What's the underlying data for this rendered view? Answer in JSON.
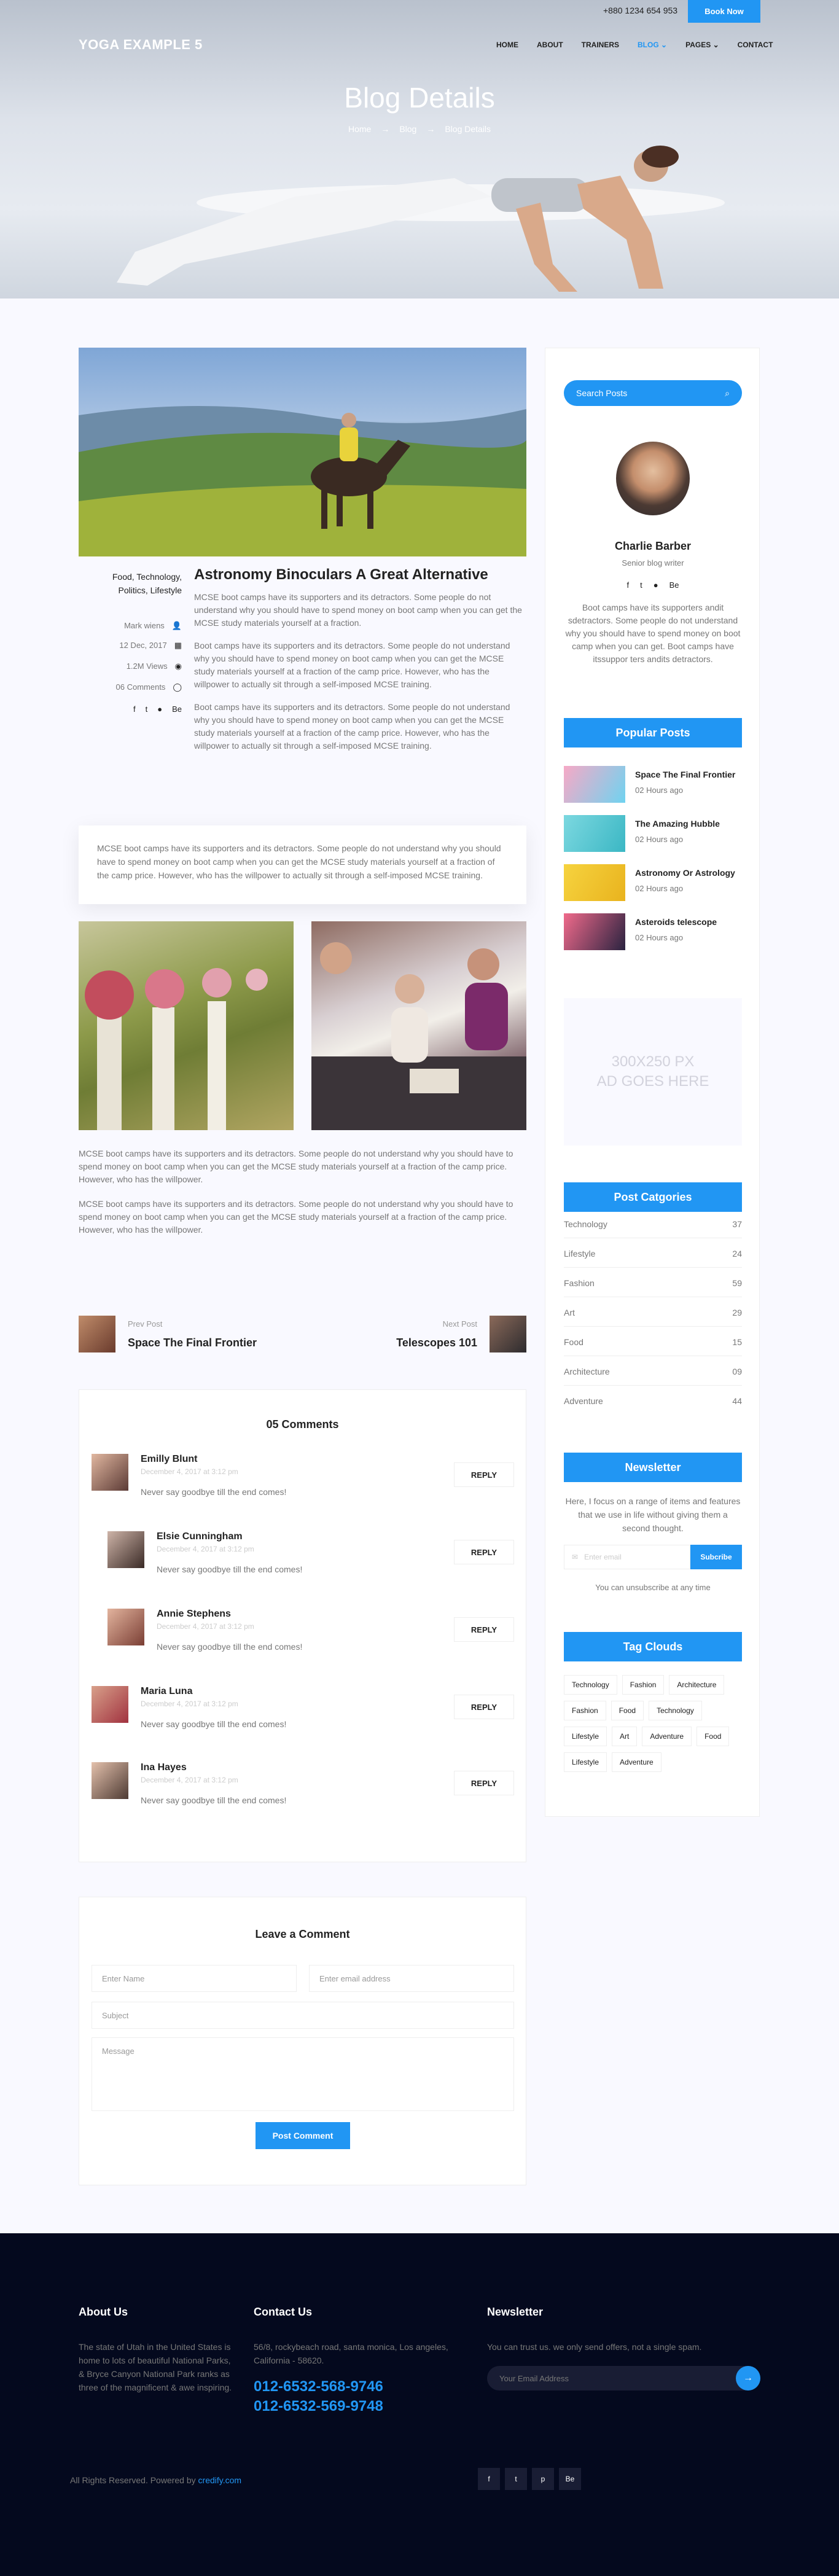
{
  "topbar": {
    "phone": "+880 1234 654 953",
    "book_label": "Book Now"
  },
  "brand": {
    "logo": "YOGA EXAMPLE 5"
  },
  "nav": {
    "items": [
      "HOME",
      "ABOUT",
      "TRAINERS",
      "BLOG",
      "PAGES",
      "CONTACT"
    ],
    "active": "BLOG"
  },
  "banner": {
    "title": "Blog Details",
    "crumbs": [
      "Home",
      "Blog",
      "Blog Details"
    ]
  },
  "post": {
    "categories": "Food, Technology, Politics, Lifestyle",
    "author": "Mark wiens",
    "date": "12 Dec, 2017",
    "views": "1.2M Views",
    "comments": "06 Comments",
    "title": "Astronomy Binoculars A Great Alternative",
    "p1": "MCSE boot camps have its supporters and its detractors. Some people do not understand why you should have to spend money on boot camp when you can get the MCSE study materials yourself at a fraction.",
    "p2": "Boot camps have its supporters and its detractors. Some people do not understand why you should have to spend money on boot camp when you can get the MCSE study materials yourself at a fraction of the camp price. However, who has the willpower to actually sit through a self-imposed MCSE training.",
    "p3": "Boot camps have its supporters and its detractors. Some people do not understand why you should have to spend money on boot camp when you can get the MCSE study materials yourself at a fraction of the camp price. However, who has the willpower to actually sit through a self-imposed MCSE training.",
    "quote": "MCSE boot camps have its supporters and its detractors. Some people do not understand why you should have to spend money on boot camp when you can get the MCSE study materials yourself at a fraction of the camp price. However, who has the willpower to actually sit through a self-imposed MCSE training.",
    "p4": "MCSE boot camps have its supporters and its detractors. Some people do not understand why you should have to spend money on boot camp when you can get the MCSE study materials yourself at a fraction of the camp price. However, who has the willpower.",
    "p5": "MCSE boot camps have its supporters and its detractors. Some people do not understand why you should have to spend money on boot camp when you can get the MCSE study materials yourself at a fraction of the camp price. However, who has the willpower."
  },
  "post_nav": {
    "prev_label": "Prev Post",
    "prev_title": "Space The Final Frontier",
    "next_label": "Next Post",
    "next_title": "Telescopes 101"
  },
  "comments": {
    "heading": "05 Comments",
    "reply_label": "REPLY",
    "items": [
      {
        "name": "Emilly Blunt",
        "date": "December 4, 2017 at 3:12 pm",
        "text": "Never say goodbye till the end comes!"
      },
      {
        "name": "Elsie Cunningham",
        "date": "December 4, 2017 at 3:12 pm",
        "text": "Never say goodbye till the end comes!"
      },
      {
        "name": "Annie Stephens",
        "date": "December 4, 2017 at 3:12 pm",
        "text": "Never say goodbye till the end comes!"
      },
      {
        "name": "Maria Luna",
        "date": "December 4, 2017 at 3:12 pm",
        "text": "Never say goodbye till the end comes!"
      },
      {
        "name": "Ina Hayes",
        "date": "December 4, 2017 at 3:12 pm",
        "text": "Never say goodbye till the end comes!"
      }
    ]
  },
  "comment_form": {
    "heading": "Leave a Comment",
    "name_ph": "Enter Name",
    "email_ph": "Enter email address",
    "subject_ph": "Subject",
    "message_ph": "Message",
    "submit": "Post Comment"
  },
  "sidebar": {
    "search_ph": "Search Posts",
    "author_name": "Charlie Barber",
    "author_role": "Senior blog writer",
    "author_bio": "Boot camps have its supporters andit sdetractors. Some people do not understand why you should have to spend money on boot camp when you can get. Boot camps have itssuppor ters andits detractors.",
    "popular_heading": "Popular Posts",
    "popular": [
      {
        "title": "Space The Final Frontier",
        "time": "02 Hours ago"
      },
      {
        "title": "The Amazing Hubble",
        "time": "02 Hours ago"
      },
      {
        "title": "Astronomy Or Astrology",
        "time": "02 Hours ago"
      },
      {
        "title": "Asteroids telescope",
        "time": "02 Hours ago"
      }
    ],
    "ad_line1": "300X250 PX",
    "ad_line2": "AD GOES HERE",
    "cat_heading": "Post Catgories",
    "categories": [
      {
        "name": "Technology",
        "count": "37"
      },
      {
        "name": "Lifestyle",
        "count": "24"
      },
      {
        "name": "Fashion",
        "count": "59"
      },
      {
        "name": "Art",
        "count": "29"
      },
      {
        "name": "Food",
        "count": "15"
      },
      {
        "name": "Architecture",
        "count": "09"
      },
      {
        "name": "Adventure",
        "count": "44"
      }
    ],
    "nl_heading": "Newsletter",
    "nl_text": "Here, I focus on a range of items and features that we use in life without giving them a second thought.",
    "nl_ph": "Enter email",
    "nl_btn": "Subcribe",
    "nl_note": "You can unsubscribe at any time",
    "tags_heading": "Tag Clouds",
    "tags": [
      "Technology",
      "Fashion",
      "Architecture",
      "Fashion",
      "Food",
      "Technology",
      "Lifestyle",
      "Art",
      "Adventure",
      "Food",
      "Lifestyle",
      "Adventure"
    ]
  },
  "footer": {
    "about_heading": "About Us",
    "about_text": "The state of Utah in the United States is home to lots of beautiful National Parks, & Bryce Canyon National Park ranks as three of the magnificent & awe inspiring.",
    "contact_heading": "Contact Us",
    "contact_address": "56/8, rockybeach road, santa monica, Los angeles, California - 58620.",
    "phone1": "012-6532-568-9746",
    "phone2": "012-6532-569-9748",
    "nl_heading": "Newsletter",
    "nl_text": "You can trust us. we only send offers, not a single spam.",
    "nl_ph": "Your Email Address",
    "copyright": "All Rights Reserved. Powered by",
    "copyright_link": "credify.com",
    "social": [
      "f",
      "t",
      "p",
      "Be"
    ]
  }
}
